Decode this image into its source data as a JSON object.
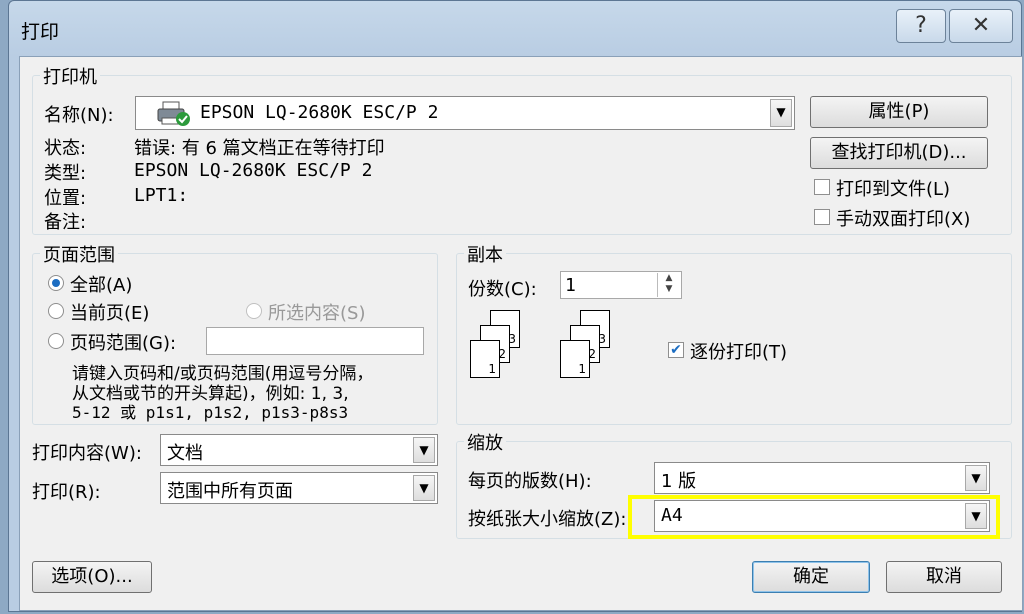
{
  "window": {
    "title": "打印",
    "help_label": "?",
    "close_label": "✕"
  },
  "printer": {
    "group_label": "打印机",
    "name_label": "名称(N):",
    "name_value": "EPSON LQ-2680K ESC/P 2",
    "status_label": "状态:",
    "status_value": "错误: 有 6 篇文档正在等待打印",
    "type_label": "类型:",
    "type_value": "EPSON LQ-2680K ESC/P 2",
    "location_label": "位置:",
    "location_value": "LPT1:",
    "comment_label": "备注:",
    "properties_button": "属性(P)",
    "find_printer_button": "查找打印机(D)...",
    "print_to_file_label": "打印到文件(L)",
    "print_to_file_checked": false,
    "manual_duplex_label": "手动双面打印(X)",
    "manual_duplex_checked": false
  },
  "page_range": {
    "group_label": "页面范围",
    "all_label": "全部(A)",
    "current_label": "当前页(E)",
    "selection_label": "所选内容(S)",
    "pages_label": "页码范围(G):",
    "pages_value": "",
    "selected": "all",
    "hint_line1": "请键入页码和/或页码范围(用逗号分隔，",
    "hint_line2": "从文档或节的开头算起)，例如: 1, 3,",
    "hint_line3": "5-12 或 p1s1, p1s2, p1s3-p8s3"
  },
  "print_what": {
    "label": "打印内容(W):",
    "value": "文档"
  },
  "print_scope": {
    "label": "打印(R):",
    "value": "范围中所有页面"
  },
  "copies": {
    "group_label": "副本",
    "count_label": "份数(C):",
    "count_value": "1",
    "collate_label": "逐份打印(T)",
    "collate_checked": true,
    "page_numbers": [
      "1",
      "2",
      "3"
    ]
  },
  "zoom": {
    "group_label": "缩放",
    "pages_per_sheet_label": "每页的版数(H):",
    "pages_per_sheet_value": "1 版",
    "scale_to_paper_label": "按纸张大小缩放(Z):",
    "scale_to_paper_value": "A4",
    "highlight_color": "#ffff00"
  },
  "footer": {
    "options_button": "选项(O)...",
    "ok_button": "确定",
    "cancel_button": "取消"
  },
  "icons": {
    "printer": "printer-icon",
    "ready_badge": "check-badge-icon",
    "dropdown": "chevron-down-icon",
    "spin": "spin-arrows-icon"
  }
}
